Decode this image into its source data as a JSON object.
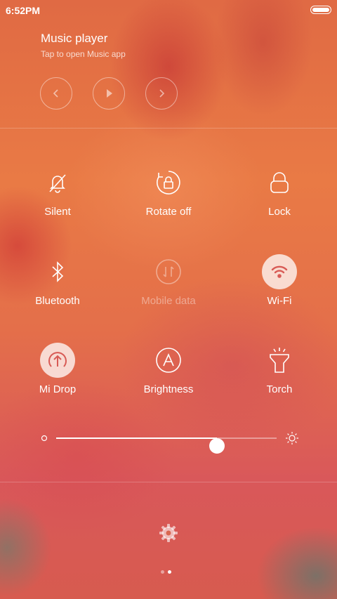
{
  "status_bar": {
    "time": "6:52PM",
    "battery_level": 1.0
  },
  "music": {
    "title": "Music player",
    "subtitle": "Tap to open Music app",
    "controls": [
      "previous-icon",
      "play-icon",
      "next-icon"
    ]
  },
  "toggles": [
    {
      "label": "Silent",
      "icon": "bell-off-icon",
      "state": "off"
    },
    {
      "label": "Rotate off",
      "icon": "rotate-lock-icon",
      "state": "off"
    },
    {
      "label": "Lock",
      "icon": "lock-icon",
      "state": "off"
    },
    {
      "label": "Bluetooth",
      "icon": "bluetooth-icon",
      "state": "off"
    },
    {
      "label": "Mobile data",
      "icon": "mobile-data-icon",
      "state": "disabled"
    },
    {
      "label": "Wi-Fi",
      "icon": "wifi-icon",
      "state": "on"
    },
    {
      "label": "Mi Drop",
      "icon": "mi-drop-icon",
      "state": "on"
    },
    {
      "label": "Brightness",
      "icon": "auto-brightness-icon",
      "state": "off"
    },
    {
      "label": "Torch",
      "icon": "torch-icon",
      "state": "off"
    }
  ],
  "brightness": {
    "level": 0.73
  },
  "pager": {
    "count": 2,
    "active_index": 1
  }
}
